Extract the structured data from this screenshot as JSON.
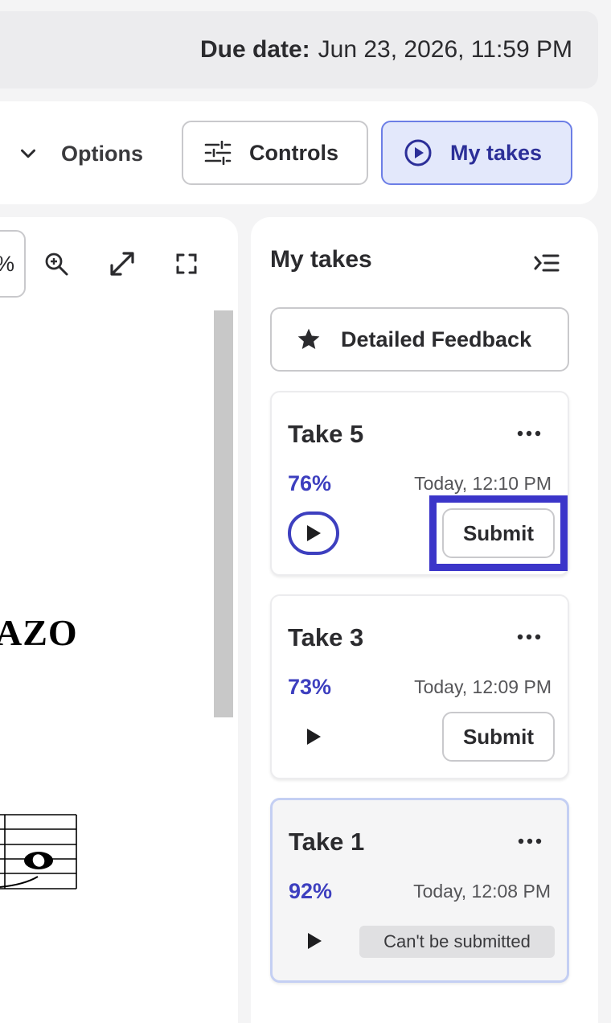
{
  "due": {
    "label": "Due date:",
    "value": "Jun 23, 2026, 11:59 PM"
  },
  "toolbar": {
    "options_label": "Options",
    "controls_label": "Controls",
    "my_takes_label": "My takes"
  },
  "score": {
    "zoom_text": "%",
    "title_fragment": "AZO",
    "icons": [
      "zoom-in-icon",
      "resize-icon",
      "fullscreen-icon"
    ]
  },
  "takes_panel": {
    "title": "My takes",
    "feedback_label": "Detailed Feedback",
    "takes": [
      {
        "title": "Take 5",
        "score": "76%",
        "time": "Today, 12:10 PM",
        "action": "Submit"
      },
      {
        "title": "Take 3",
        "score": "73%",
        "time": "Today, 12:09 PM",
        "action": "Submit"
      },
      {
        "title": "Take 1",
        "score": "92%",
        "time": "Today, 12:08 PM",
        "action": "Can't be submitted"
      }
    ]
  },
  "colors": {
    "accent": "#3d3fbf",
    "accent_bg": "#e3e8fb",
    "highlight": "#3b35c9",
    "selected_border": "#c4cff3"
  }
}
